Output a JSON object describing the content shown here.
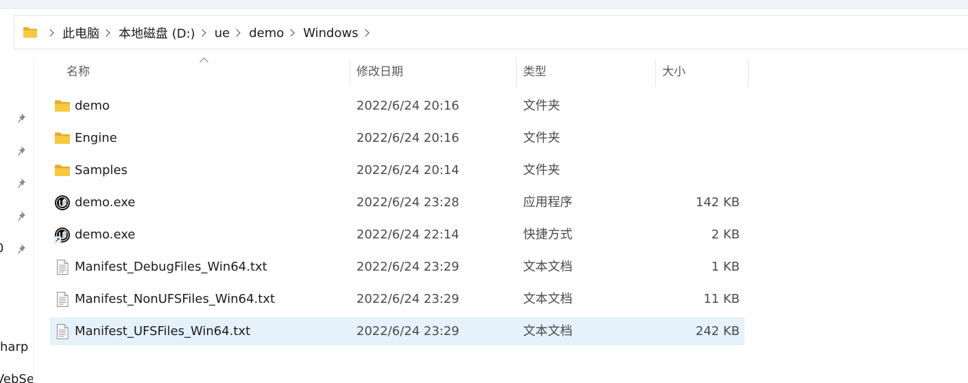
{
  "breadcrumb": [
    "此电脑",
    "本地磁盘 (D:)",
    "ue",
    "demo",
    "Windows"
  ],
  "left_pane": {
    "partial_labels": [
      "0",
      "harp",
      "VebSer"
    ]
  },
  "columns": {
    "name": "名称",
    "modified": "修改日期",
    "type": "类型",
    "size": "大小"
  },
  "files": [
    {
      "name": "demo",
      "modified": "2022/6/24 20:16",
      "type": "文件夹",
      "size": "",
      "icon": "folder-icon"
    },
    {
      "name": "Engine",
      "modified": "2022/6/24 20:16",
      "type": "文件夹",
      "size": "",
      "icon": "folder-icon"
    },
    {
      "name": "Samples",
      "modified": "2022/6/24 20:14",
      "type": "文件夹",
      "size": "",
      "icon": "folder-icon"
    },
    {
      "name": "demo.exe",
      "modified": "2022/6/24 23:28",
      "type": "应用程序",
      "size": "142 KB",
      "icon": "unreal-app-icon"
    },
    {
      "name": "demo.exe",
      "modified": "2022/6/24 22:14",
      "type": "快捷方式",
      "size": "2 KB",
      "icon": "unreal-shortcut-icon"
    },
    {
      "name": "Manifest_DebugFiles_Win64.txt",
      "modified": "2022/6/24 23:29",
      "type": "文本文档",
      "size": "1 KB",
      "icon": "text-file-icon"
    },
    {
      "name": "Manifest_NonUFSFiles_Win64.txt",
      "modified": "2022/6/24 23:29",
      "type": "文本文档",
      "size": "11 KB",
      "icon": "text-file-icon"
    },
    {
      "name": "Manifest_UFSFiles_Win64.txt",
      "modified": "2022/6/24 23:29",
      "type": "文本文档",
      "size": "242 KB",
      "icon": "text-file-icon",
      "selected": true
    }
  ],
  "colors": {
    "folder": "#f8c940",
    "selection": "#e5f1fb"
  }
}
